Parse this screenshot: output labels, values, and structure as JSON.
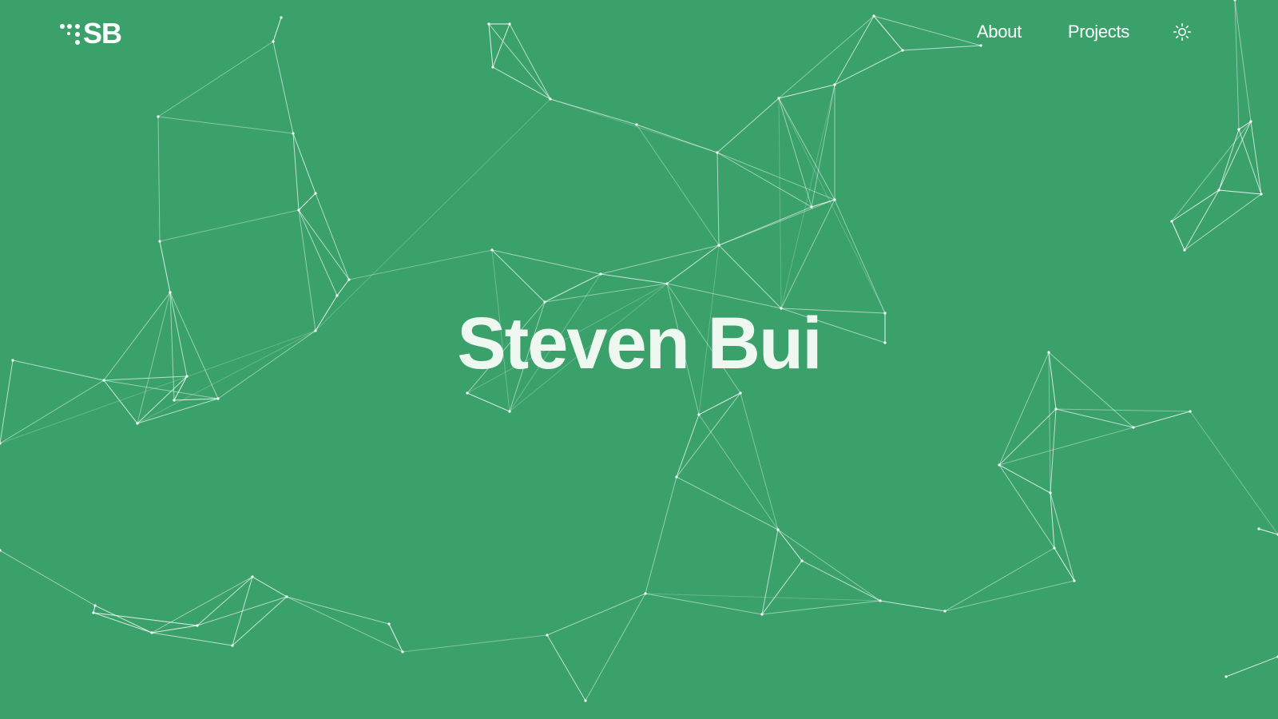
{
  "theme": {
    "background": "#3aa16b",
    "foreground": "#ffffff",
    "title_color": "#eef7f0"
  },
  "header": {
    "logo": {
      "text": "SB",
      "icon": "dot-grid-icon"
    },
    "nav": [
      {
        "label": "About"
      },
      {
        "label": "Projects"
      }
    ],
    "theme_toggle": {
      "icon": "sun-icon"
    }
  },
  "hero": {
    "title": "Steven Bui",
    "background_pattern": "particle-network"
  }
}
